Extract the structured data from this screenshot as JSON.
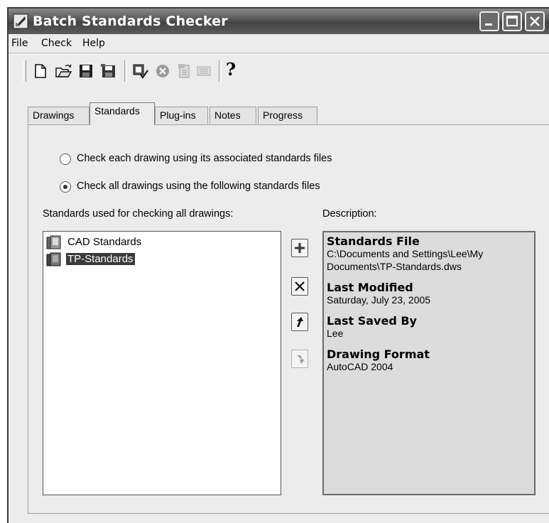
{
  "window": {
    "title": "Batch Standards Checker"
  },
  "menubar": {
    "items": [
      "File",
      "Check",
      "Help"
    ]
  },
  "toolbar": {
    "buttons": [
      "new-icon",
      "open-icon",
      "save-icon",
      "save-as-icon",
      "check-standards-icon",
      "stop-check-icon",
      "view-report-icon",
      "export-report-icon",
      "help-icon"
    ],
    "help_glyph": "?"
  },
  "tabs": [
    "Drawings",
    "Standards",
    "Plug-ins",
    "Notes",
    "Progress"
  ],
  "active_tab": "Standards",
  "options": {
    "associated": "Check each drawing using its associated standards files",
    "following": "Check all drawings using the following standards files",
    "selected": "following"
  },
  "standards_list": {
    "label": "Standards used for checking all drawings:",
    "items": [
      {
        "name": "CAD Standards",
        "selected": false
      },
      {
        "name": "TP-Standards",
        "selected": true
      }
    ]
  },
  "side_buttons": {
    "add": "add-icon",
    "remove": "remove-icon",
    "move_up": "move-up-icon",
    "move_down": "move-down-icon (disabled)"
  },
  "description": {
    "label": "Description:",
    "blocks": [
      {
        "heading": "Standards File",
        "value": "C:\\Documents and Settings\\Lee\\My Documents\\TP-Standards.dws"
      },
      {
        "heading": "Last Modified",
        "value": "Saturday, July 23, 2005"
      },
      {
        "heading": "Last Saved By",
        "value": "Lee"
      },
      {
        "heading": "Drawing Format",
        "value": "AutoCAD 2004"
      }
    ]
  }
}
